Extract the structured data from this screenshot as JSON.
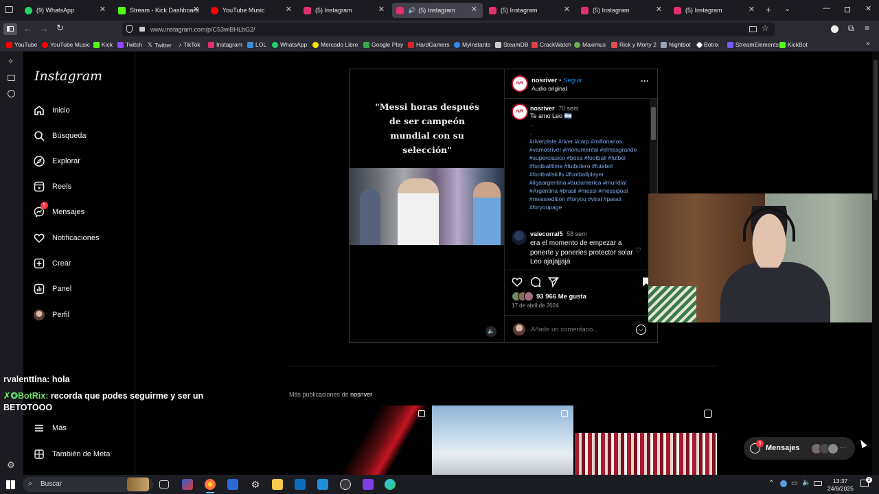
{
  "tabs": [
    {
      "label": "(9) WhatsApp",
      "color": "#25d366"
    },
    {
      "label": "Stream - Kick Dashboard",
      "color": "#53fc18"
    },
    {
      "label": "YouTube Music",
      "color": "#ff0000"
    },
    {
      "label": "(5) Instagram",
      "color": "#e1306c"
    },
    {
      "label": "(5) Instagram",
      "color": "#e1306c"
    },
    {
      "label": "(5) Instagram",
      "color": "#e1306c"
    },
    {
      "label": "(5) Instagram",
      "color": "#e1306c"
    },
    {
      "label": "(5) Instagram",
      "color": "#e1306c"
    }
  ],
  "url": "www.instagram.com/p/C53wiBHLbG2/",
  "bookmarks": [
    {
      "label": "YouTube",
      "color": "#ff0000"
    },
    {
      "label": "YouTube Music",
      "color": "#ff0000"
    },
    {
      "label": "Kick",
      "color": "#53fc18"
    },
    {
      "label": "Twitch",
      "color": "#9146ff"
    },
    {
      "label": "Twitter",
      "color": "#ffffff"
    },
    {
      "label": "TikTok",
      "color": "#ffffff"
    },
    {
      "label": "Instagram",
      "color": "#e1306c"
    },
    {
      "label": "LOL",
      "color": "#3a8fd8"
    },
    {
      "label": "WhatsApp",
      "color": "#25d366"
    },
    {
      "label": "Mercado Libre",
      "color": "#ffe600"
    },
    {
      "label": "Google Play",
      "color": "#34a853"
    },
    {
      "label": "HardGamers",
      "color": "#d02a2a"
    },
    {
      "label": "MyInstants",
      "color": "#2d8cf0"
    },
    {
      "label": "SteamDB",
      "color": "#cccccc"
    },
    {
      "label": "CrackWatch",
      "color": "#e04040"
    },
    {
      "label": "Maximus",
      "color": "#6ab04c"
    },
    {
      "label": "Rick y Morty 2",
      "color": "#e05050"
    },
    {
      "label": "Nightbot",
      "color": "#9aa4b8"
    },
    {
      "label": "Botrix",
      "color": "#ffffff"
    },
    {
      "label": "StreamElements",
      "color": "#7a5af8"
    },
    {
      "label": "KickBot",
      "color": "#53fc18"
    }
  ],
  "ig": {
    "logo": "Instagram",
    "nav": [
      "Inicio",
      "Búsqueda",
      "Explorar",
      "Reels",
      "Mensajes",
      "Notificaciones",
      "Crear",
      "Panel",
      "Perfil"
    ],
    "messages_badge": "5",
    "more": "Más",
    "meta": "También de Meta"
  },
  "post": {
    "caption_overlay": "\"Messi horas después de ser campeón mundial con su selección\"",
    "author": "nosriver",
    "follow": "Seguir",
    "audio": "Audio original",
    "avatar_text": "N/R",
    "comment_author": "nosriver",
    "comment_age": "70 sem",
    "comment_text": "Te amo Leo 🇦🇷",
    "dots": ".",
    "hashtags": "#riverplate #river #carp #millonarios #vamosriver #monumental #elmasgrande #superclasico #boca #football #futbol #footballtime #futbolero #futebol #footballskills #footballplayer #ligaargentina #sudamerica #mundial #Argentina #brasil #messi #messigoal #messiedition #foryou #viral #parati #foryoupage",
    "reply_author": "valecorral5",
    "reply_age": "58 sem",
    "reply_text": "era el momento de empezar a ponerte y ponerles protector solar Leo ajajajjaja",
    "likes": "93 966 Me gusta",
    "date": "17 de abril de 2024",
    "add_comment": "Añade un comentario..."
  },
  "more_posts_prefix": "Más publicaciones de",
  "more_posts_user": "nosriver",
  "chat": [
    {
      "user": "rvalenttina:",
      "text": "hola"
    },
    {
      "user": "✗✪BotRix:",
      "text": "recorda que podes seguirme y ser un BETOTOOO"
    }
  ],
  "messages_pill": {
    "label": "Mensajes",
    "badge": "5"
  },
  "taskbar": {
    "search": "Buscar",
    "time": "13:37",
    "date": "24/8/2025",
    "notif_badge": "2"
  }
}
